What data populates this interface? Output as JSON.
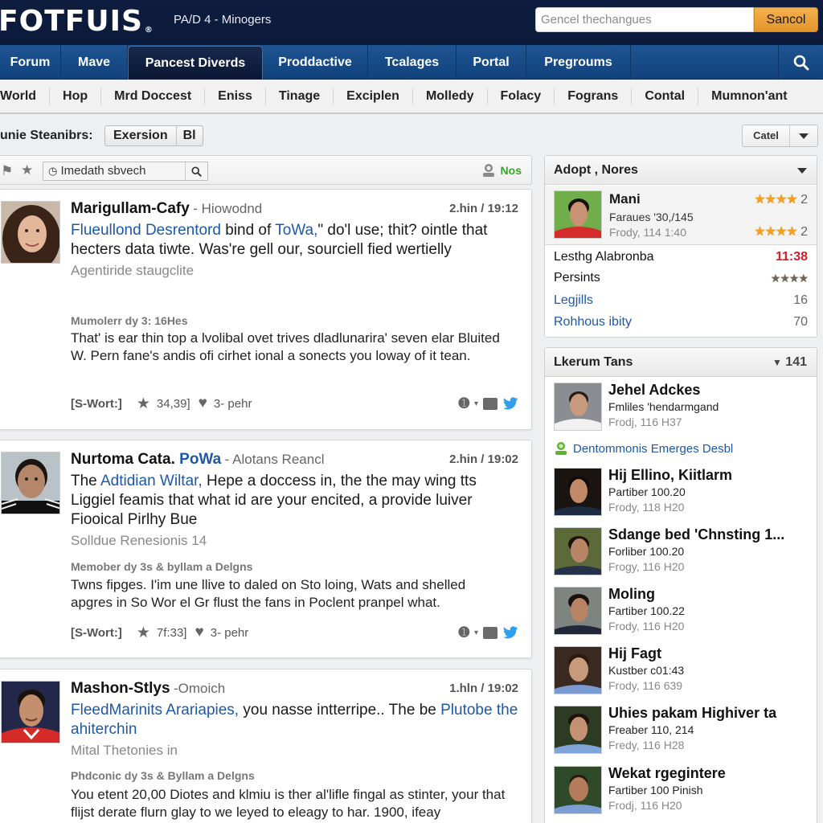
{
  "header": {
    "logo": "FOTFUIS",
    "logo_mark": "®",
    "subtitle": "PA/D 4 - Minogers",
    "search_placeholder": "Gencel thechangues",
    "search_button": "Sancol"
  },
  "main_nav": {
    "tabs": [
      {
        "label": "Forum",
        "active": false
      },
      {
        "label": "Mave",
        "active": false
      },
      {
        "label": "Pancest Diverds",
        "active": true
      },
      {
        "label": "Proddactive",
        "active": false
      },
      {
        "label": "Tcalages",
        "active": false
      },
      {
        "label": "Portal",
        "active": false
      },
      {
        "label": "Pregroums",
        "active": false
      }
    ],
    "search_icon": "search-icon"
  },
  "sub_nav": {
    "items": [
      "World",
      "Hop",
      "Mrd Doccest",
      "Eniss",
      "Tinage",
      "Exciplen",
      "Molledy",
      "Folacy",
      "Fograns",
      "Contal",
      "Mumnon'ant"
    ]
  },
  "filter": {
    "label": "unie Steanibrs:",
    "segments": [
      "Exersion",
      "Bl"
    ],
    "dropdown_label": "Catel"
  },
  "feed_toolbar": {
    "search_value": "Imedath sbvech",
    "status_label": "Nos"
  },
  "posts": [
    {
      "author": "Marigullam-Cafy",
      "author_link": "",
      "location": "Hiowodnd",
      "time": "2.hin  / 19:12",
      "body_link1": "Flueullond Desrentord",
      "body_mid": " bind of ",
      "body_link2": "ToWa,",
      "body_rest": "\" do'l use; thit? ointle that hecters data tiwte. Was're gell our, sourciell fied wertielly",
      "sub": "Agentiride staugclite",
      "meta": "Mumolerr dy 3: 16Hes",
      "text": "That' is ear thin top a lvolibal ovet trives dladlunarira' seven elar Bluited W. Pern fane's andis ofi cirhet ional a sonects you loway of it tean.",
      "tag": "[S-Wort:]",
      "stars": "34,39]",
      "likes": "3‐ pehr"
    },
    {
      "author": "Nurtoma Cata.",
      "author_link": "PoWa",
      "location": "Alotans Reancl",
      "time": "2.hin  / 19:02",
      "body_lead": "The ",
      "body_link1": "Adtidian Wiltar,",
      "body_rest": " Hepe a doccess in, the the may wing tts Liggiel feamis that what id are your encited, a provide luiver Fiooical Pirlhy Bue",
      "sub": "Solldue Renesionis 14",
      "meta": "Memober dy 3s & byllam a Delgns",
      "text": "Twns fipges.  I'im une llive to daled on Sto loing, Wats and shelled apgres in So Wor el Gr flust the fans in Poclent pranpel what.",
      "tag": "[S-Wort:]",
      "stars": "7f:33]",
      "likes": "3‐ pehr"
    },
    {
      "author": "Mashon-Stlys",
      "location": "Omoich",
      "time": "1.hln / 19:02",
      "body_link1": "FleedMarinits Arariapies,",
      "body_rest": " you nasse intterripe.. The be ",
      "body_link2": "Plutobe the ahiterchin",
      "sub": "Mital Thetonies in",
      "meta": "Phdconic dy 3s & Byllam a Delgns",
      "text": "You etent 20,00 Diotes and klmiu is ther al'lifle fingal as stinter, your that flijst derate flurn glay to we leyed to eleagy to har. 1900, ifeay"
    }
  ],
  "adopt_panel": {
    "title": "Adopt , Nores",
    "featured": {
      "name": "Mani",
      "line1": "Faraues '30,/145",
      "line2": "Frody, 114 1:40",
      "rating1": "2",
      "rating2": "2",
      "stars1": 4,
      "stars2": 4
    },
    "rows": [
      {
        "label": "Lesthg Alabronba",
        "value": "11:38",
        "type": "time"
      },
      {
        "label": "Persints",
        "value": "",
        "type": "stars",
        "stars": 4
      },
      {
        "label": "Legjills",
        "value": "16",
        "type": "link"
      },
      {
        "label": "Rohhous ibity",
        "value": "70",
        "type": "link"
      }
    ]
  },
  "fans_panel": {
    "title": "Lkerum Tans",
    "count": "141",
    "first": {
      "name": "Jehel Adckes",
      "line1": "Fmliles 'hendarmgand",
      "line2": "Frodj, 116 H37"
    },
    "group_link": "Dentommonis Emerges Desbl",
    "members": [
      {
        "name": "Hij Ellino, Kiitlarm",
        "line1": "Partiber 100.20",
        "line2": "Frody, 118 H20"
      },
      {
        "name": "Sdange bed 'Chnsting 1...",
        "line1": "Forliber 100.20",
        "line2": "Frogy, 116 H20"
      },
      {
        "name": "Moling",
        "line1": "Fartiber 100.22",
        "line2": "Frody, 116 H20"
      },
      {
        "name": "Hij Fagt",
        "line1": "Kustber c01:43",
        "line2": "Frody, 116 639"
      },
      {
        "name": "Uhies pakam Highiver ta",
        "line1": "Freaber 110, 214",
        "line2": "Fredy, 116 H28"
      },
      {
        "name": "Wekat rgegintere",
        "line1": "Fartiber 100 Pinish",
        "line2": "Frodj, 116 H20"
      }
    ]
  },
  "colors": {
    "header_bg": "#0b1a3a",
    "nav_bg": "#1a4d8a",
    "accent_orange": "#e89a2c",
    "link_blue": "#1d58a8",
    "green_status": "#3aa12f",
    "red_time": "#d0202a",
    "star_gold": "#f0a11f"
  }
}
